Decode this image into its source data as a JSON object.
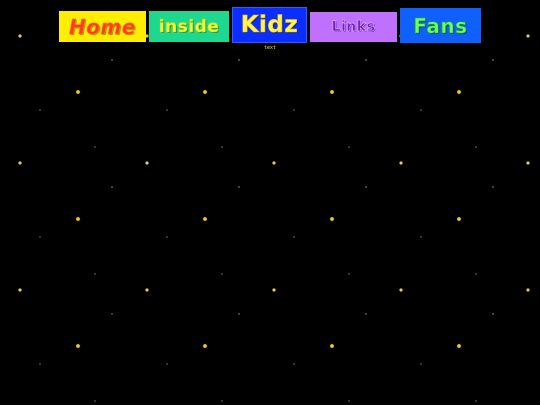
{
  "nav": {
    "items": [
      {
        "label": "Home"
      },
      {
        "label": "inside"
      },
      {
        "label": "Kidz"
      },
      {
        "label": "Links"
      },
      {
        "label": "Fans"
      }
    ]
  },
  "caption": "text",
  "colors": {
    "background": "#000000",
    "home_bg": "#ffee00",
    "inside_bg": "#1ed890",
    "kidz_bg": "#0a2eff",
    "links_bg": "#c070ff",
    "fans_bg": "#1060ff"
  }
}
